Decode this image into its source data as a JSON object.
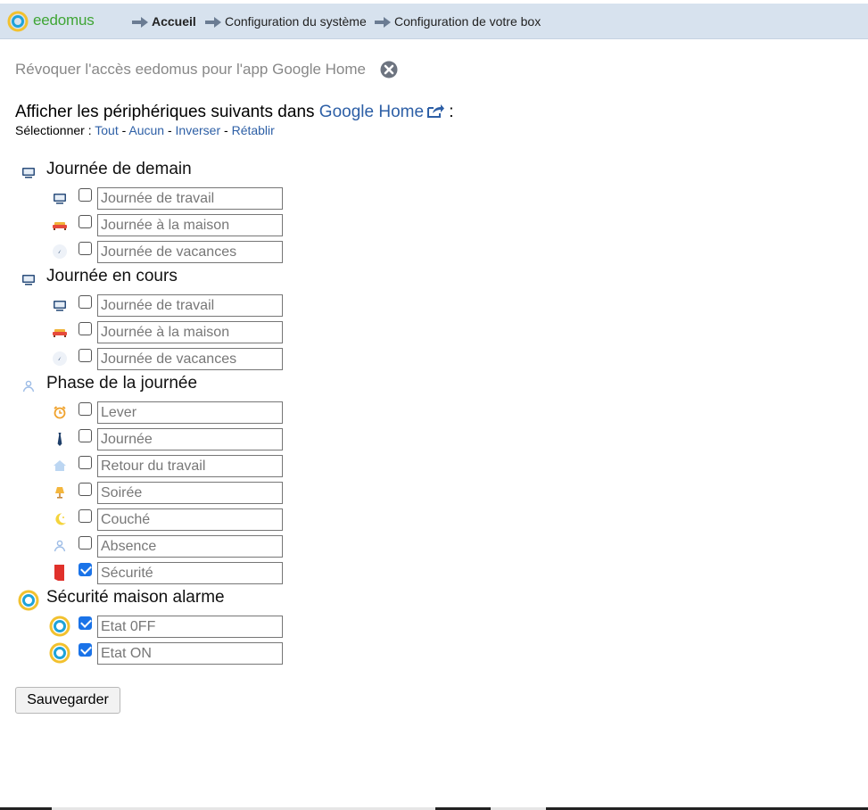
{
  "app": {
    "brand": "eedomus"
  },
  "breadcrumb": [
    {
      "label": "Accueil",
      "bold": true
    },
    {
      "label": "Configuration du système",
      "bold": false
    },
    {
      "label": "Configuration de votre box",
      "bold": false
    }
  ],
  "revoke": {
    "label": "Révoquer l'accès eedomus pour l'app Google Home"
  },
  "heading": {
    "prefix": "Afficher les périphériques suivants dans ",
    "link": "Google Home",
    "suffix": " :"
  },
  "select": {
    "label": "Sélectionner : ",
    "all": "Tout",
    "none": "Aucun",
    "invert": "Inverser",
    "reset": "Rétablir",
    "sep": " - "
  },
  "groups": [
    {
      "title": "Journée de demain",
      "icon": "monitor-icon",
      "items": [
        {
          "value": "Journée de travail",
          "icon": "monitor-icon",
          "checked": false
        },
        {
          "value": "Journée à la maison",
          "icon": "sofa-icon",
          "checked": false
        },
        {
          "value": "Journée de vacances",
          "icon": "compass-icon",
          "checked": false
        }
      ]
    },
    {
      "title": "Journée en cours",
      "icon": "monitor-icon",
      "items": [
        {
          "value": "Journée de travail",
          "icon": "monitor-icon",
          "checked": false
        },
        {
          "value": "Journée à la maison",
          "icon": "sofa-icon",
          "checked": false
        },
        {
          "value": "Journée de vacances",
          "icon": "compass-icon",
          "checked": false
        }
      ]
    },
    {
      "title": "Phase de la journée",
      "icon": "person-icon",
      "items": [
        {
          "value": "Lever",
          "icon": "alarm-clock-icon",
          "checked": false
        },
        {
          "value": "Journée",
          "icon": "tie-icon",
          "checked": false
        },
        {
          "value": "Retour du travail",
          "icon": "house-icon",
          "checked": false
        },
        {
          "value": "Soirée",
          "icon": "lamp-icon",
          "checked": false
        },
        {
          "value": "Couché",
          "icon": "moon-icon",
          "checked": false
        },
        {
          "value": "Absence",
          "icon": "person-icon",
          "checked": false
        },
        {
          "value": "Sécurité",
          "icon": "security-flag-icon",
          "checked": true
        }
      ]
    },
    {
      "title": "Sécurité maison alarme",
      "icon": "eedomus-ring-icon",
      "items": [
        {
          "value": "Etat 0FF",
          "icon": "eedomus-ring-icon",
          "checked": true
        },
        {
          "value": "Etat ON",
          "icon": "eedomus-ring-icon",
          "checked": true
        }
      ]
    }
  ],
  "save": {
    "label": "Sauvegarder"
  },
  "colors": {
    "topbar": "#d7e2ee",
    "link": "#2d5fa6",
    "brand_green": "#3fa535",
    "brand_yellow": "#f2c12e",
    "brand_blue": "#1fa3d9"
  }
}
